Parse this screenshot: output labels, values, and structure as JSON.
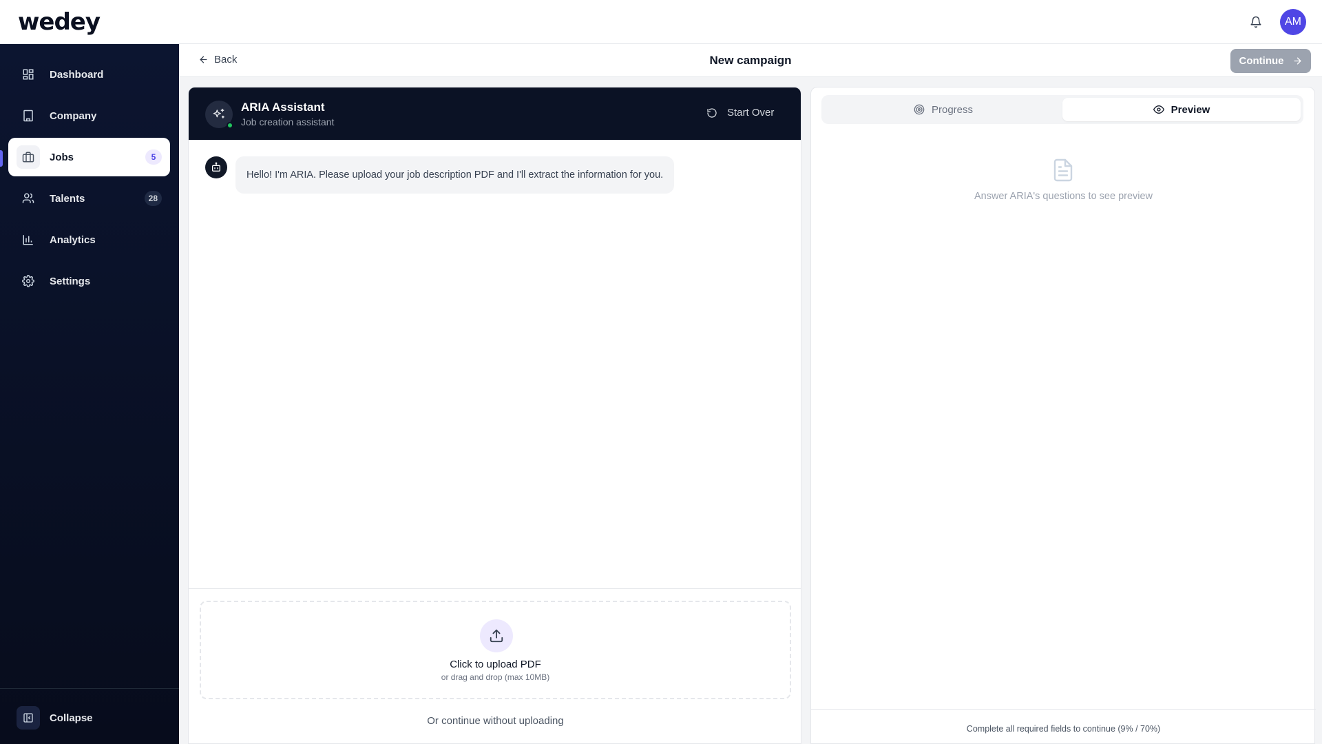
{
  "app": {
    "logo": "wedey"
  },
  "user": {
    "initials": "AM"
  },
  "sidebar": {
    "items": [
      {
        "label": "Dashboard",
        "icon": "dashboard-icon"
      },
      {
        "label": "Company",
        "icon": "building-icon"
      },
      {
        "label": "Jobs",
        "icon": "briefcase-icon",
        "badge": "5",
        "active": true
      },
      {
        "label": "Talents",
        "icon": "users-icon",
        "badge": "28"
      },
      {
        "label": "Analytics",
        "icon": "bar-chart-icon"
      },
      {
        "label": "Settings",
        "icon": "gear-icon"
      }
    ],
    "collapse_label": "Collapse"
  },
  "subheader": {
    "back_label": "Back",
    "title": "New campaign",
    "continue_label": "Continue"
  },
  "chat": {
    "assistant_name": "ARIA Assistant",
    "assistant_subtitle": "Job creation assistant",
    "start_over_label": "Start Over",
    "messages": [
      {
        "from": "assistant",
        "text": "Hello! I'm ARIA. Please upload your job description PDF and I'll extract the information for you."
      }
    ],
    "upload": {
      "title": "Click to upload PDF",
      "subtitle": "or drag and drop (max 10MB)"
    },
    "skip_label": "Or continue without uploading"
  },
  "preview": {
    "tabs": {
      "progress": "Progress",
      "preview": "Preview"
    },
    "empty_text": "Answer ARIA's questions to see preview",
    "footer_text": "Complete all required fields to continue (9% / 70%)"
  },
  "colors": {
    "sidebar_bg": "#0b1225",
    "accent": "#4f46e5",
    "online": "#22c55e",
    "continue_disabled": "#9ca3af"
  }
}
